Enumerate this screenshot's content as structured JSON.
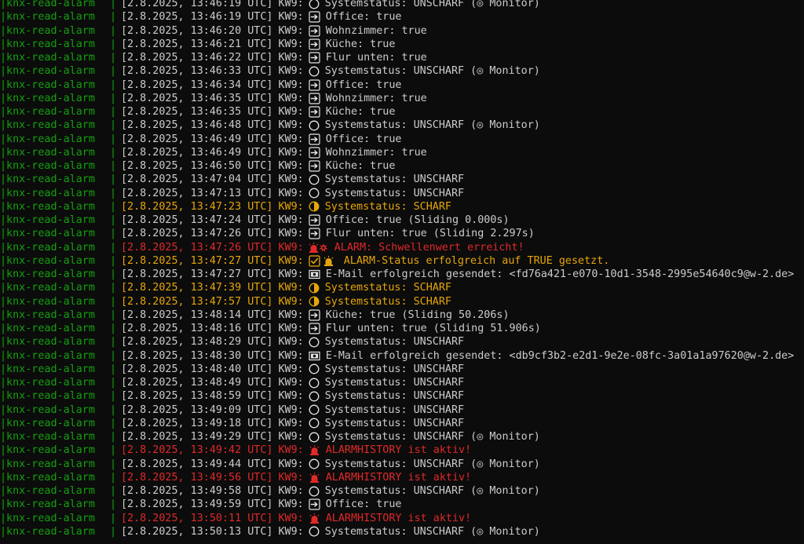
{
  "prefix": "|knx-read-alarm",
  "separator": "|",
  "colors": {
    "background": "#0c0c0c",
    "text": "#cccccc",
    "prefix": "#13a10e",
    "warning": "#e5a50a",
    "alarm": "#e02929"
  },
  "lines": [
    {
      "ts": "[2.8.2025, 13:46:19 UTC]",
      "kw": "KW9:",
      "icon": "circle-icon",
      "msg": "Systemstatus: UNSCHARF (◎ Monitor)",
      "level": "normal"
    },
    {
      "ts": "[2.8.2025, 13:46:19 UTC]",
      "kw": "KW9:",
      "icon": "arrow-box-icon",
      "msg": "Office: true",
      "level": "normal"
    },
    {
      "ts": "[2.8.2025, 13:46:20 UTC]",
      "kw": "KW9:",
      "icon": "arrow-box-icon",
      "msg": "Wohnzimmer: true",
      "level": "normal"
    },
    {
      "ts": "[2.8.2025, 13:46:21 UTC]",
      "kw": "KW9:",
      "icon": "arrow-box-icon",
      "msg": "Küche: true",
      "level": "normal"
    },
    {
      "ts": "[2.8.2025, 13:46:22 UTC]",
      "kw": "KW9:",
      "icon": "arrow-box-icon",
      "msg": "Flur unten: true",
      "level": "normal"
    },
    {
      "ts": "[2.8.2025, 13:46:33 UTC]",
      "kw": "KW9:",
      "icon": "circle-icon",
      "msg": "Systemstatus: UNSCHARF (◎ Monitor)",
      "level": "normal"
    },
    {
      "ts": "[2.8.2025, 13:46:34 UTC]",
      "kw": "KW9:",
      "icon": "arrow-box-icon",
      "msg": "Office: true",
      "level": "normal"
    },
    {
      "ts": "[2.8.2025, 13:46:35 UTC]",
      "kw": "KW9:",
      "icon": "arrow-box-icon",
      "msg": "Wohnzimmer: true",
      "level": "normal"
    },
    {
      "ts": "[2.8.2025, 13:46:35 UTC]",
      "kw": "KW9:",
      "icon": "arrow-box-icon",
      "msg": "Küche: true",
      "level": "normal"
    },
    {
      "ts": "[2.8.2025, 13:46:48 UTC]",
      "kw": "KW9:",
      "icon": "circle-icon",
      "msg": "Systemstatus: UNSCHARF (◎ Monitor)",
      "level": "normal"
    },
    {
      "ts": "[2.8.2025, 13:46:49 UTC]",
      "kw": "KW9:",
      "icon": "arrow-box-icon",
      "msg": "Office: true",
      "level": "normal"
    },
    {
      "ts": "[2.8.2025, 13:46:49 UTC]",
      "kw": "KW9:",
      "icon": "arrow-box-icon",
      "msg": "Wohnzimmer: true",
      "level": "normal"
    },
    {
      "ts": "[2.8.2025, 13:46:50 UTC]",
      "kw": "KW9:",
      "icon": "arrow-box-icon",
      "msg": "Küche: true",
      "level": "normal"
    },
    {
      "ts": "[2.8.2025, 13:47:04 UTC]",
      "kw": "KW9:",
      "icon": "circle-icon",
      "msg": "Systemstatus: UNSCHARF",
      "level": "normal"
    },
    {
      "ts": "[2.8.2025, 13:47:13 UTC]",
      "kw": "KW9:",
      "icon": "circle-icon",
      "msg": "Systemstatus: UNSCHARF",
      "level": "normal"
    },
    {
      "ts": "[2.8.2025, 13:47:23 UTC]",
      "kw": "KW9:",
      "icon": "half-moon-icon",
      "msg": "Systemstatus: SCHARF",
      "level": "warn"
    },
    {
      "ts": "[2.8.2025, 13:47:24 UTC]",
      "kw": "KW9:",
      "icon": "arrow-box-icon",
      "msg": "Office: true (Sliding 0.000s)",
      "level": "normal"
    },
    {
      "ts": "[2.8.2025, 13:47:26 UTC]",
      "kw": "KW9:",
      "icon": "arrow-box-icon",
      "msg": "Flur unten: true (Sliding 2.297s)",
      "level": "normal"
    },
    {
      "ts": "[2.8.2025, 13:47:26 UTC]",
      "kw": "KW9:",
      "icon": "siren-burst-icon",
      "msg": "ALARM: Schwellenwert erreicht!",
      "level": "alarm"
    },
    {
      "ts": "[2.8.2025, 13:47:27 UTC]",
      "kw": "KW9:",
      "icon": "check-siren-icon",
      "msg": "ALARM-Status erfolgreich auf TRUE gesetzt.",
      "level": "warn"
    },
    {
      "ts": "[2.8.2025, 13:47:27 UTC]",
      "kw": "KW9:",
      "icon": "email-icon",
      "msg": "E-Mail erfolgreich gesendet: <fd76a421-e070-10d1-3548-2995e54640c9@w-2.de>",
      "level": "normal"
    },
    {
      "ts": "[2.8.2025, 13:47:39 UTC]",
      "kw": "KW9:",
      "icon": "half-moon-icon",
      "msg": "Systemstatus: SCHARF",
      "level": "warn"
    },
    {
      "ts": "[2.8.2025, 13:47:57 UTC]",
      "kw": "KW9:",
      "icon": "half-moon-icon",
      "msg": "Systemstatus: SCHARF",
      "level": "warn"
    },
    {
      "ts": "[2.8.2025, 13:48:14 UTC]",
      "kw": "KW9:",
      "icon": "arrow-box-icon",
      "msg": "Küche: true (Sliding 50.206s)",
      "level": "normal"
    },
    {
      "ts": "[2.8.2025, 13:48:16 UTC]",
      "kw": "KW9:",
      "icon": "arrow-box-icon",
      "msg": "Flur unten: true (Sliding 51.906s)",
      "level": "normal"
    },
    {
      "ts": "[2.8.2025, 13:48:29 UTC]",
      "kw": "KW9:",
      "icon": "circle-icon",
      "msg": "Systemstatus: UNSCHARF",
      "level": "normal"
    },
    {
      "ts": "[2.8.2025, 13:48:30 UTC]",
      "kw": "KW9:",
      "icon": "email-icon",
      "msg": "E-Mail erfolgreich gesendet: <db9cf3b2-e2d1-9e2e-08fc-3a01a1a97620@w-2.de>",
      "level": "normal"
    },
    {
      "ts": "[2.8.2025, 13:48:40 UTC]",
      "kw": "KW9:",
      "icon": "circle-icon",
      "msg": "Systemstatus: UNSCHARF",
      "level": "normal"
    },
    {
      "ts": "[2.8.2025, 13:48:49 UTC]",
      "kw": "KW9:",
      "icon": "circle-icon",
      "msg": "Systemstatus: UNSCHARF",
      "level": "normal"
    },
    {
      "ts": "[2.8.2025, 13:48:59 UTC]",
      "kw": "KW9:",
      "icon": "circle-icon",
      "msg": "Systemstatus: UNSCHARF",
      "level": "normal"
    },
    {
      "ts": "[2.8.2025, 13:49:09 UTC]",
      "kw": "KW9:",
      "icon": "circle-icon",
      "msg": "Systemstatus: UNSCHARF",
      "level": "normal"
    },
    {
      "ts": "[2.8.2025, 13:49:18 UTC]",
      "kw": "KW9:",
      "icon": "circle-icon",
      "msg": "Systemstatus: UNSCHARF",
      "level": "normal"
    },
    {
      "ts": "[2.8.2025, 13:49:29 UTC]",
      "kw": "KW9:",
      "icon": "circle-icon",
      "msg": "Systemstatus: UNSCHARF (◎ Monitor)",
      "level": "normal"
    },
    {
      "ts": "[2.8.2025, 13:49:42 UTC]",
      "kw": "KW9:",
      "icon": "siren-icon",
      "msg": "ALARMHISTORY ist aktiv!",
      "level": "alarm"
    },
    {
      "ts": "[2.8.2025, 13:49:44 UTC]",
      "kw": "KW9:",
      "icon": "circle-icon",
      "msg": "Systemstatus: UNSCHARF (◎ Monitor)",
      "level": "normal"
    },
    {
      "ts": "[2.8.2025, 13:49:56 UTC]",
      "kw": "KW9:",
      "icon": "siren-icon",
      "msg": "ALARMHISTORY ist aktiv!",
      "level": "alarm"
    },
    {
      "ts": "[2.8.2025, 13:49:58 UTC]",
      "kw": "KW9:",
      "icon": "circle-icon",
      "msg": "Systemstatus: UNSCHARF (◎ Monitor)",
      "level": "normal"
    },
    {
      "ts": "[2.8.2025, 13:49:59 UTC]",
      "kw": "KW9:",
      "icon": "arrow-box-icon",
      "msg": "Office: true",
      "level": "normal"
    },
    {
      "ts": "[2.8.2025, 13:50:11 UTC]",
      "kw": "KW9:",
      "icon": "siren-icon",
      "msg": "ALARMHISTORY ist aktiv!",
      "level": "alarm"
    },
    {
      "ts": "[2.8.2025, 13:50:13 UTC]",
      "kw": "KW9:",
      "icon": "circle-icon",
      "msg": "Systemstatus: UNSCHARF (◎ Monitor)",
      "level": "normal"
    }
  ]
}
